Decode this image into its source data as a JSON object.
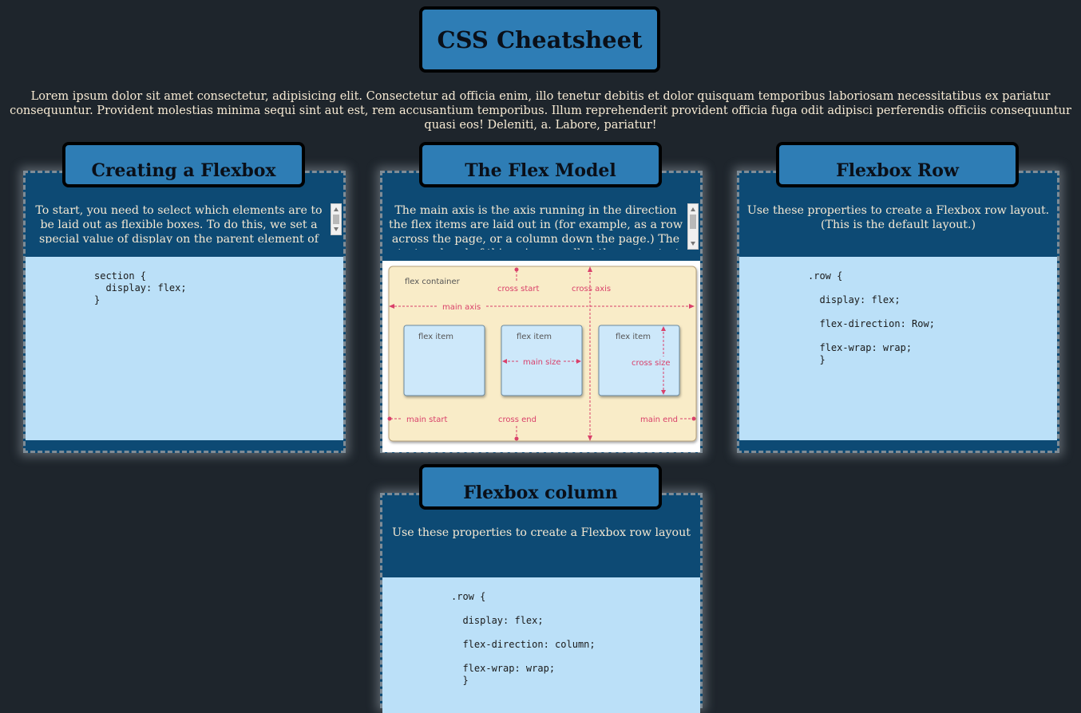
{
  "page": {
    "title": "CSS Cheatsheet",
    "intro": "Lorem ipsum dolor sit amet consectetur, adipisicing elit. Consectetur ad officia enim, illo tenetur debitis et dolor quisquam temporibus laboriosam necessitatibus ex pariatur consequuntur. Provident molestias minima sequi sint aut est, rem accusantium temporibus. Illum reprehenderit provident officia fuga odit adipisci perferendis officiis consequuntur quasi eos! Deleniti, a. Labore, pariatur!"
  },
  "cards": {
    "creating": {
      "title": "Creating a Flexbox",
      "desc": "To start, you need to select which elements are to be laid out as flexible boxes. To do this, we set a special value of display on the parent element of the elements",
      "code": "section {\n  display: flex;\n}"
    },
    "model": {
      "title": "The Flex Model",
      "desc": "The main axis is the axis running in the direction the flex items are laid out in (for example, as a row across the page, or a column down the page.) The start and end of this axis are called the main start and main end."
    },
    "row": {
      "title": "Flexbox Row",
      "desc": "Use these properties to create a Flexbox row layout. (This is the default layout.)",
      "code": ".row {\n\n  display: flex;\n\n  flex-direction: Row;\n\n  flex-wrap: wrap;\n  }"
    },
    "column": {
      "title": "Flexbox column",
      "desc": "Use these properties to create a Flexbox row layout",
      "code": ".row {\n\n  display: flex;\n\n  flex-direction: column;\n\n  flex-wrap: wrap;\n  }"
    }
  },
  "diagram": {
    "container_label": "flex container",
    "cross_start": "cross start",
    "cross_axis": "cross axis",
    "main_axis": "main axis",
    "item_label": "flex item",
    "main_size": "main size",
    "cross_size": "cross size",
    "main_start": "main start",
    "cross_end": "cross end",
    "main_end": "main end",
    "colors": {
      "container": "#f9ecc8",
      "item": "#cde8fa",
      "accent": "#d9406a"
    }
  }
}
